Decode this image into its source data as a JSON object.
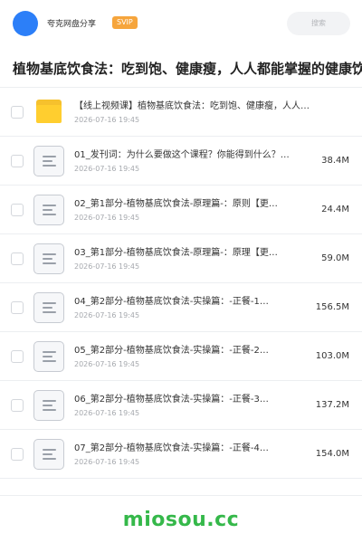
{
  "header": {
    "share_name": "夸克网盘分享",
    "badge": "SVIP",
    "search_placeholder": "搜索",
    "colors": {
      "avatar": "#2c7ff8",
      "badge": "#f6a53c"
    }
  },
  "page_title": "植物基底饮食法：吃到饱、健康瘦，人人都能掌握的健康饮",
  "files": [
    {
      "type": "folder",
      "name": "【线上视频课】植物基底饮食法：吃到饱、健康瘦，人人…",
      "date": "2026-07-16 19:45",
      "size": ""
    },
    {
      "type": "doc",
      "name": "01_发刊词：为什么要做这个课程？你能得到什么？【…",
      "date": "2026-07-16 19:45",
      "size": "38.4M"
    },
    {
      "type": "doc",
      "name": "02_第1部分-植物基底饮食法-原理篇-：原则【更…",
      "date": "2026-07-16 19:45",
      "size": "24.4M"
    },
    {
      "type": "doc",
      "name": "03_第1部分-植物基底饮食法-原理篇-：原理【更…",
      "date": "2026-07-16 19:45",
      "size": "59.0M"
    },
    {
      "type": "doc",
      "name": "04_第2部分-植物基底饮食法-实操篇：-正餐-1…",
      "date": "2026-07-16 19:45",
      "size": "156.5M"
    },
    {
      "type": "doc",
      "name": "05_第2部分-植物基底饮食法-实操篇：-正餐-2…",
      "date": "2026-07-16 19:45",
      "size": "103.0M"
    },
    {
      "type": "doc",
      "name": "06_第2部分-植物基底饮食法-实操篇：-正餐-3…",
      "date": "2026-07-16 19:45",
      "size": "137.2M"
    },
    {
      "type": "doc",
      "name": "07_第2部分-植物基底饮食法-实操篇：-正餐-4…",
      "date": "2026-07-16 19:45",
      "size": "154.0M"
    }
  ],
  "watermark": "miosou.cc",
  "icons": {
    "folder": "folder-icon",
    "doc": "document-icon"
  }
}
